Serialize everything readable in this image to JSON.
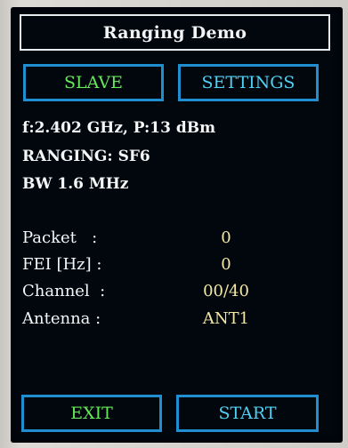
{
  "header": {
    "title": "Ranging Demo"
  },
  "mode_button": {
    "label": "SLAVE"
  },
  "settings_button": {
    "label": "SETTINGS"
  },
  "radio_info": {
    "line1": "f:2.402 GHz, P:13 dBm",
    "line2": "RANGING: SF6",
    "line3": "BW 1.6 MHz"
  },
  "stats": [
    {
      "label": "Packet   :",
      "value": "0"
    },
    {
      "label": "FEI [Hz] :",
      "value": "0"
    },
    {
      "label": "Channel  :",
      "value": "00/40"
    },
    {
      "label": "Antenna :",
      "value": "ANT1"
    }
  ],
  "footer": {
    "exit_label": "EXIT",
    "start_label": "START"
  },
  "colors": {
    "screen_bg": "#02060d",
    "button_border": "#1f8fd1",
    "green_text": "#67e85a",
    "cyan_text": "#4fd0f2",
    "value_text": "#f2e7a4"
  }
}
